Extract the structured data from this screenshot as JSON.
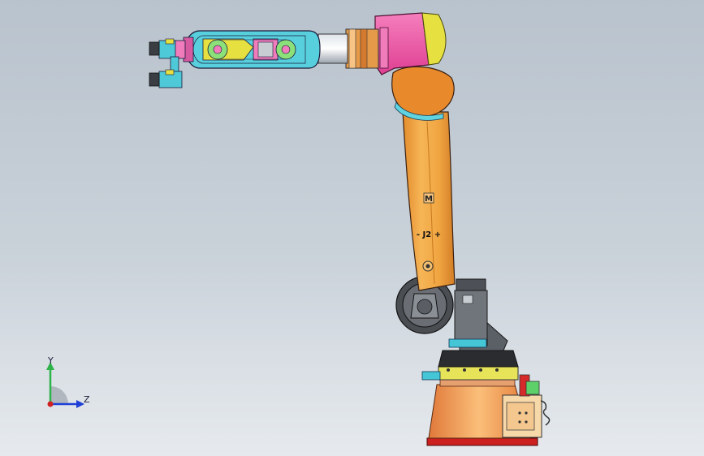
{
  "viewport": {
    "background_top": "#b9c3cd",
    "background_bottom": "#e6eaee"
  },
  "robot": {
    "arm_label": "- J2 +",
    "arm_marker": "M",
    "colors": {
      "arm": "#f0a541",
      "arm_dark": "#d4842b",
      "shoulder": "#e8892c",
      "head": "#ee5aa5",
      "head_cap": "#e6e040",
      "wrist": "#4ec9d8",
      "base": "#f3a15a",
      "base_plate": "#cc2020",
      "motor": "#7a7e84",
      "lines": "#1a1a3a"
    }
  },
  "triad": {
    "y_label": "Y",
    "z_label": "Z",
    "y_color": "#2db34a",
    "z_color": "#1e3fd6",
    "x_color": "#d02020"
  }
}
